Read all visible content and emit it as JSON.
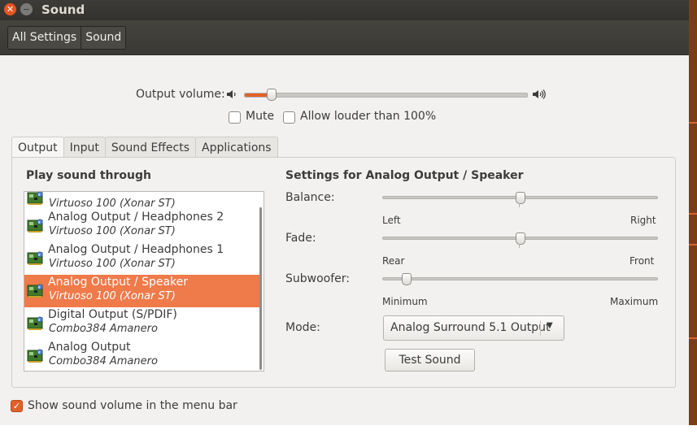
{
  "window": {
    "title": "Sound"
  },
  "titlebar": {
    "close_icon": "close-icon",
    "minimize_icon": "minimize-icon"
  },
  "breadcrumb": {
    "items": [
      "All Settings",
      "Sound"
    ]
  },
  "output_volume": {
    "label": "Output volume:",
    "level_percent": 8,
    "low_icon": "speaker-low-icon",
    "high_icon": "speaker-high-icon"
  },
  "mute": {
    "label": "Mute",
    "checked": false
  },
  "allow_louder": {
    "label": "Allow louder than 100%",
    "checked": false
  },
  "tabs": [
    "Output",
    "Input",
    "Sound Effects",
    "Applications"
  ],
  "active_tab": "Output",
  "devices": {
    "heading": "Play sound through",
    "items": [
      {
        "name": "",
        "card": "Virtuoso 100 (Xonar ST)",
        "selected": false
      },
      {
        "name": "Analog Output / Headphones 2",
        "card": "Virtuoso 100 (Xonar ST)",
        "selected": false
      },
      {
        "name": "Analog Output / Headphones 1",
        "card": "Virtuoso 100 (Xonar ST)",
        "selected": false
      },
      {
        "name": "Analog Output / Speaker",
        "card": "Virtuoso 100 (Xonar ST)",
        "selected": true
      },
      {
        "name": "Digital Output (S/PDIF)",
        "card": "Combo384 Amanero",
        "selected": false
      },
      {
        "name": "Analog Output",
        "card": "Combo384 Amanero",
        "selected": false
      }
    ]
  },
  "settings": {
    "heading": "Settings for Analog Output / Speaker",
    "balance": {
      "label": "Balance:",
      "min": "Left",
      "max": "Right",
      "value_percent": 50
    },
    "fade": {
      "label": "Fade:",
      "min": "Rear",
      "max": "Front",
      "value_percent": 50
    },
    "subwoofer": {
      "label": "Subwoofer:",
      "min": "Minimum",
      "max": "Maximum",
      "value_percent": 7
    },
    "mode": {
      "label": "Mode:",
      "value": "Analog Surround 5.1 Output"
    },
    "test_sound": "Test Sound"
  },
  "menu_bar": {
    "label": "Show sound volume in the menu bar",
    "checked": true
  },
  "colors": {
    "accent": "#e0622a",
    "selection": "#ef7a4a",
    "titlebar": "#3d3c38"
  }
}
